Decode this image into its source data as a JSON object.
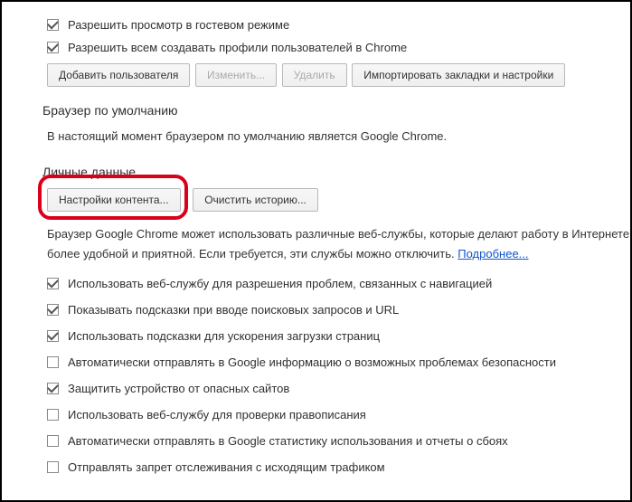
{
  "topChecks": [
    {
      "label": "Разрешить просмотр в гостевом режиме",
      "checked": true
    },
    {
      "label": "Разрешить всем создавать профили пользователей в Chrome",
      "checked": true
    }
  ],
  "userButtons": {
    "add": "Добавить пользователя",
    "edit": "Изменить...",
    "delete": "Удалить",
    "import": "Импортировать закладки и настройки"
  },
  "defaultBrowser": {
    "title": "Браузер по умолчанию",
    "text": "В настоящий момент браузером по умолчанию является Google Chrome."
  },
  "privacy": {
    "title": "Личные данные",
    "contentBtn": "Настройки контента...",
    "clearBtn": "Очистить историю...",
    "desc1": "Браузер Google Chrome может использовать различные веб-службы, которые делают работу в Интернете",
    "desc2": "более удобной и приятной. Если требуется, эти службы можно отключить. ",
    "moreLink": "Подробнее...",
    "checks": [
      {
        "label": "Использовать веб-службу для разрешения проблем, связанных с навигацией",
        "checked": true
      },
      {
        "label": "Показывать подсказки при вводе поисковых запросов и URL",
        "checked": true
      },
      {
        "label": "Использовать подсказки для ускорения загрузки страниц",
        "checked": true
      },
      {
        "label": "Автоматически отправлять в Google информацию о возможных проблемах безопасности",
        "checked": false
      },
      {
        "label": "Защитить устройство от опасных сайтов",
        "checked": true
      },
      {
        "label": "Использовать веб-службу для проверки правописания",
        "checked": false
      },
      {
        "label": "Автоматически отправлять в Google статистику использования и отчеты о сбоях",
        "checked": false
      },
      {
        "label": "Отправлять запрет отслеживания с исходящим трафиком",
        "checked": false
      }
    ]
  }
}
